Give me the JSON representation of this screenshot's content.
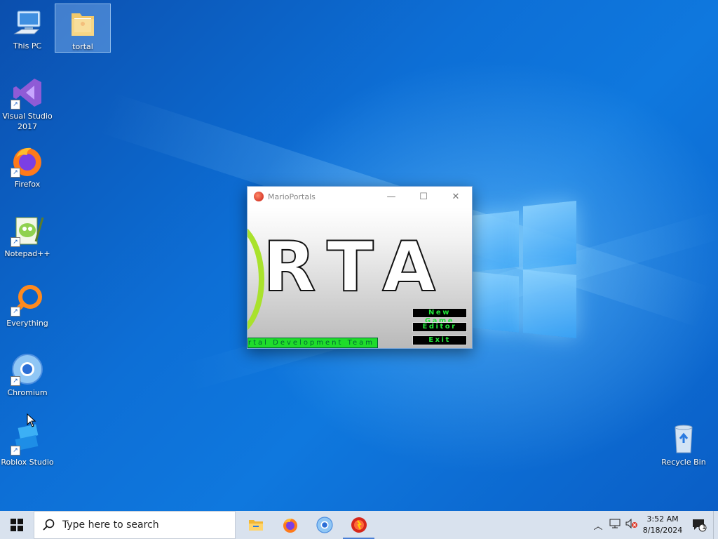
{
  "desktop": {
    "icons": [
      {
        "label": "This PC",
        "icon": "computer-icon"
      },
      {
        "label": "tortal",
        "icon": "folder-icon",
        "selected": true
      },
      {
        "label": "Visual Studio 2017",
        "icon": "visual-studio-icon"
      },
      {
        "label": "Firefox",
        "icon": "firefox-icon"
      },
      {
        "label": "Notepad++",
        "icon": "notepadpp-icon"
      },
      {
        "label": "Everything",
        "icon": "everything-search-icon"
      },
      {
        "label": "Chromium",
        "icon": "chromium-icon"
      },
      {
        "label": "Roblox Studio",
        "icon": "roblox-studio-icon"
      },
      {
        "label": "Recycle Bin",
        "icon": "recycle-bin-icon"
      }
    ]
  },
  "app_window": {
    "title": "MarioPortals",
    "controls": {
      "minimize": "—",
      "maximize": "☐",
      "close": "✕"
    },
    "game": {
      "title_fragment": "RTA",
      "menu": [
        "New Game",
        "Editor",
        "Exit"
      ],
      "credit": "rtal Development Team"
    }
  },
  "taskbar": {
    "search_placeholder": "Type here to search",
    "pinned": [
      {
        "name": "file-explorer",
        "icon": "file-explorer-icon"
      },
      {
        "name": "firefox",
        "icon": "firefox-icon"
      },
      {
        "name": "chromium",
        "icon": "chromium-icon"
      },
      {
        "name": "marioportals",
        "icon": "marioportals-icon",
        "active": true
      }
    ],
    "clock": {
      "time": "3:52 AM",
      "date": "8/18/2024"
    },
    "notification_count": "1"
  },
  "colors": {
    "accent": "#0f78de",
    "taskbar": "#d9e2ee",
    "menu_text": "#22e83a",
    "credit_bg": "#1fdc2b"
  }
}
